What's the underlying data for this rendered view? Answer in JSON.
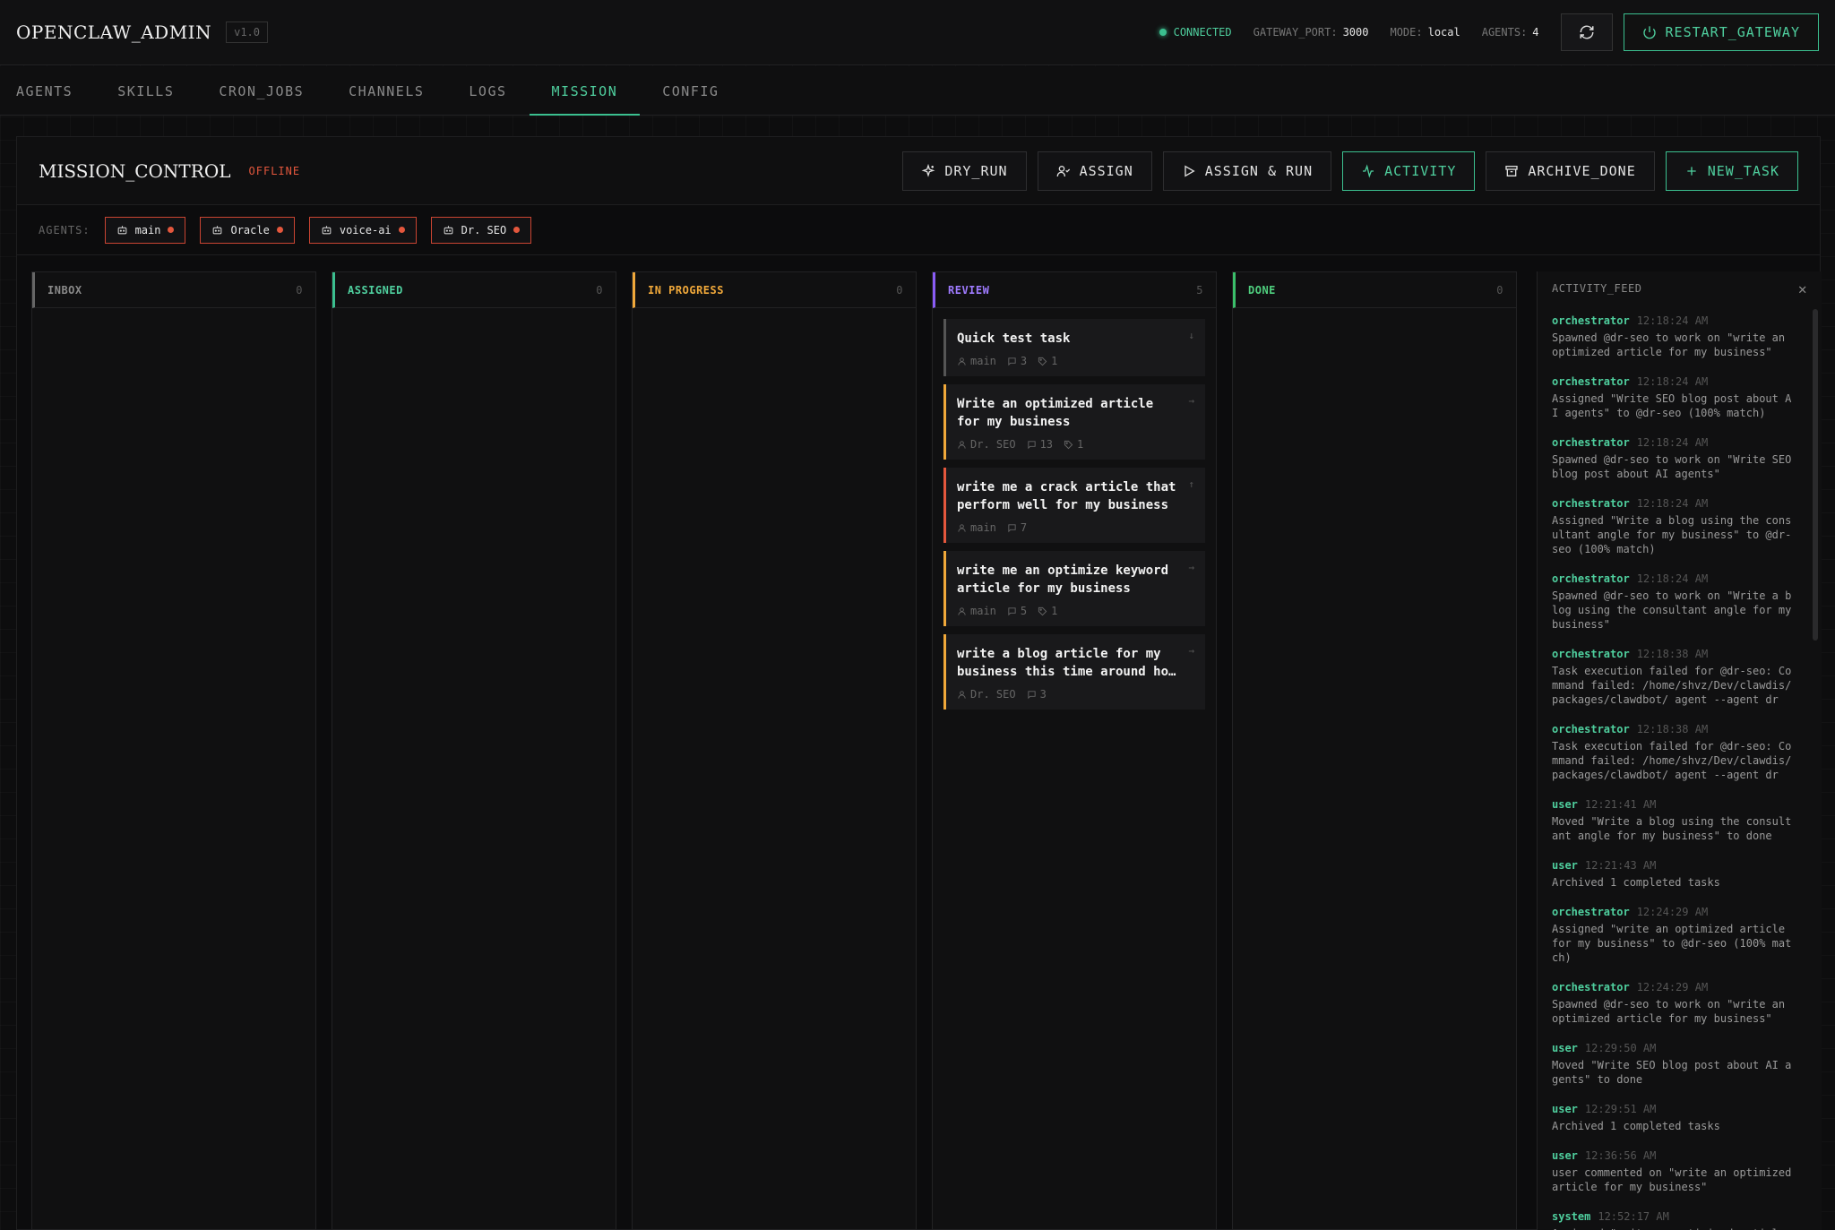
{
  "header": {
    "brand": "OPENCLAW_ADMIN",
    "version": "v1.0",
    "connected": "CONNECTED",
    "gateway_port_label": "GATEWAY_PORT:",
    "gateway_port": "3000",
    "mode_label": "MODE:",
    "mode": "local",
    "agents_label": "AGENTS:",
    "agents_count": "4",
    "restart_label": "RESTART_GATEWAY"
  },
  "nav": {
    "tabs": [
      "AGENTS",
      "SKILLS",
      "CRON_JOBS",
      "CHANNELS",
      "LOGS",
      "MISSION",
      "CONFIG"
    ],
    "active": "MISSION"
  },
  "mission": {
    "title": "MISSION_CONTROL",
    "status": "OFFLINE",
    "actions": {
      "dry_run": "DRY_RUN",
      "assign": "ASSIGN",
      "assign_run": "ASSIGN & RUN",
      "activity": "ACTIVITY",
      "archive_done": "ARCHIVE_DONE",
      "new_task": "NEW_TASK"
    },
    "agents_label": "AGENTS:",
    "agents": [
      "main",
      "Oracle",
      "voice-ai",
      "Dr. SEO"
    ]
  },
  "columns": [
    {
      "name": "INBOX",
      "count": "0"
    },
    {
      "name": "ASSIGNED",
      "count": "0"
    },
    {
      "name": "IN PROGRESS",
      "count": "0"
    },
    {
      "name": "REVIEW",
      "count": "5"
    },
    {
      "name": "DONE",
      "count": "0"
    }
  ],
  "review_cards": [
    {
      "title": "Quick test task",
      "agent": "main",
      "comments": "3",
      "tags": "1",
      "arrow": "↓"
    },
    {
      "title": "Write an optimized article for my business",
      "agent": "Dr. SEO",
      "comments": "13",
      "tags": "1",
      "arrow": "→"
    },
    {
      "title": "write me a crack article that perform well for my business",
      "agent": "main",
      "comments": "7",
      "tags": "",
      "arrow": "↑"
    },
    {
      "title": "write me an optimize keyword article for my business",
      "agent": "main",
      "comments": "5",
      "tags": "1",
      "arrow": "→"
    },
    {
      "title": "write a blog article for my business this time around ho…",
      "agent": "Dr. SEO",
      "comments": "3",
      "tags": "",
      "arrow": "→"
    }
  ],
  "feed": {
    "title": "ACTIVITY_FEED",
    "items": [
      {
        "who": "orchestrator",
        "ts": "12:18:24 AM",
        "msg": "Spawned @dr-seo to work on \"write an optimized article for my business\""
      },
      {
        "who": "orchestrator",
        "ts": "12:18:24 AM",
        "msg": "Assigned \"Write SEO blog post about AI agents\" to @dr-seo (100% match)"
      },
      {
        "who": "orchestrator",
        "ts": "12:18:24 AM",
        "msg": "Spawned @dr-seo to work on \"Write SEO blog post about AI agents\""
      },
      {
        "who": "orchestrator",
        "ts": "12:18:24 AM",
        "msg": "Assigned \"Write a blog using the consultant angle for my business\" to @dr-seo (100% match)"
      },
      {
        "who": "orchestrator",
        "ts": "12:18:24 AM",
        "msg": "Spawned @dr-seo to work on \"Write a blog using the consultant angle for my business\""
      },
      {
        "who": "orchestrator",
        "ts": "12:18:38 AM",
        "msg": "Task execution failed for @dr-seo: Command failed: /home/shvz/Dev/clawdis/packages/clawdbot/ agent --agent dr"
      },
      {
        "who": "orchestrator",
        "ts": "12:18:38 AM",
        "msg": "Task execution failed for @dr-seo: Command failed: /home/shvz/Dev/clawdis/packages/clawdbot/ agent --agent dr"
      },
      {
        "who": "user",
        "ts": "12:21:41 AM",
        "msg": "Moved \"Write a blog using the consultant angle for my business\" to done"
      },
      {
        "who": "user",
        "ts": "12:21:43 AM",
        "msg": "Archived 1 completed tasks"
      },
      {
        "who": "orchestrator",
        "ts": "12:24:29 AM",
        "msg": "Assigned \"write an optimized article for my business\" to @dr-seo (100% match)"
      },
      {
        "who": "orchestrator",
        "ts": "12:24:29 AM",
        "msg": "Spawned @dr-seo to work on \"write an optimized article for my business\""
      },
      {
        "who": "user",
        "ts": "12:29:50 AM",
        "msg": "Moved \"Write SEO blog post about AI agents\" to done"
      },
      {
        "who": "user",
        "ts": "12:29:51 AM",
        "msg": "Archived 1 completed tasks"
      },
      {
        "who": "user",
        "ts": "12:36:56 AM",
        "msg": "user commented on \"write an optimized article for my business\""
      },
      {
        "who": "system",
        "ts": "12:52:17 AM",
        "msg": "Assigned \"write an optimized article"
      }
    ]
  },
  "colors": {
    "accent": "#3bbf8f",
    "danger": "#e4573d",
    "amber": "#f0a83a",
    "purple": "#8a5cf6"
  }
}
